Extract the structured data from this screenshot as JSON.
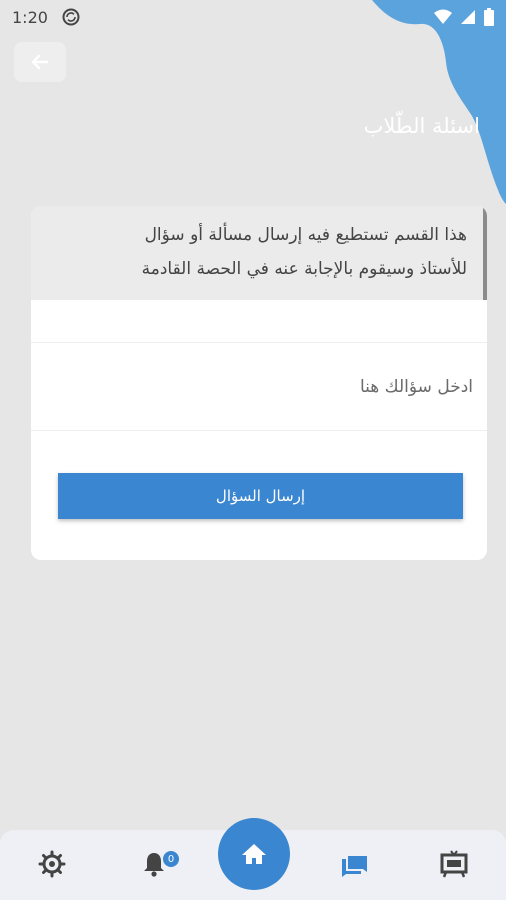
{
  "status_bar": {
    "time": "1:20"
  },
  "header": {
    "title": "اسئلة الطّلاب",
    "back_icon": "arrow-left-icon"
  },
  "card": {
    "notice_line1": "هذا القسم تستطيع فيه إرسال مسألة أو سؤال",
    "notice_line2": "للأستاذ وسيقوم بالإجابة عنه في الحصة القادمة",
    "input_placeholder": "ادخل سؤالك هنا",
    "input_value": "",
    "send_label": "إرسال السؤال"
  },
  "bottom_nav": {
    "items": [
      {
        "icon": "settings-gear-icon"
      },
      {
        "icon": "notification-bell-icon",
        "badge": "0"
      },
      {
        "icon": "home-icon"
      },
      {
        "icon": "chat-icon"
      },
      {
        "icon": "classroom-board-icon"
      }
    ]
  },
  "colors": {
    "accent": "#3a86d0",
    "background": "#e6e6e6",
    "blob": "#5ba3dc"
  }
}
